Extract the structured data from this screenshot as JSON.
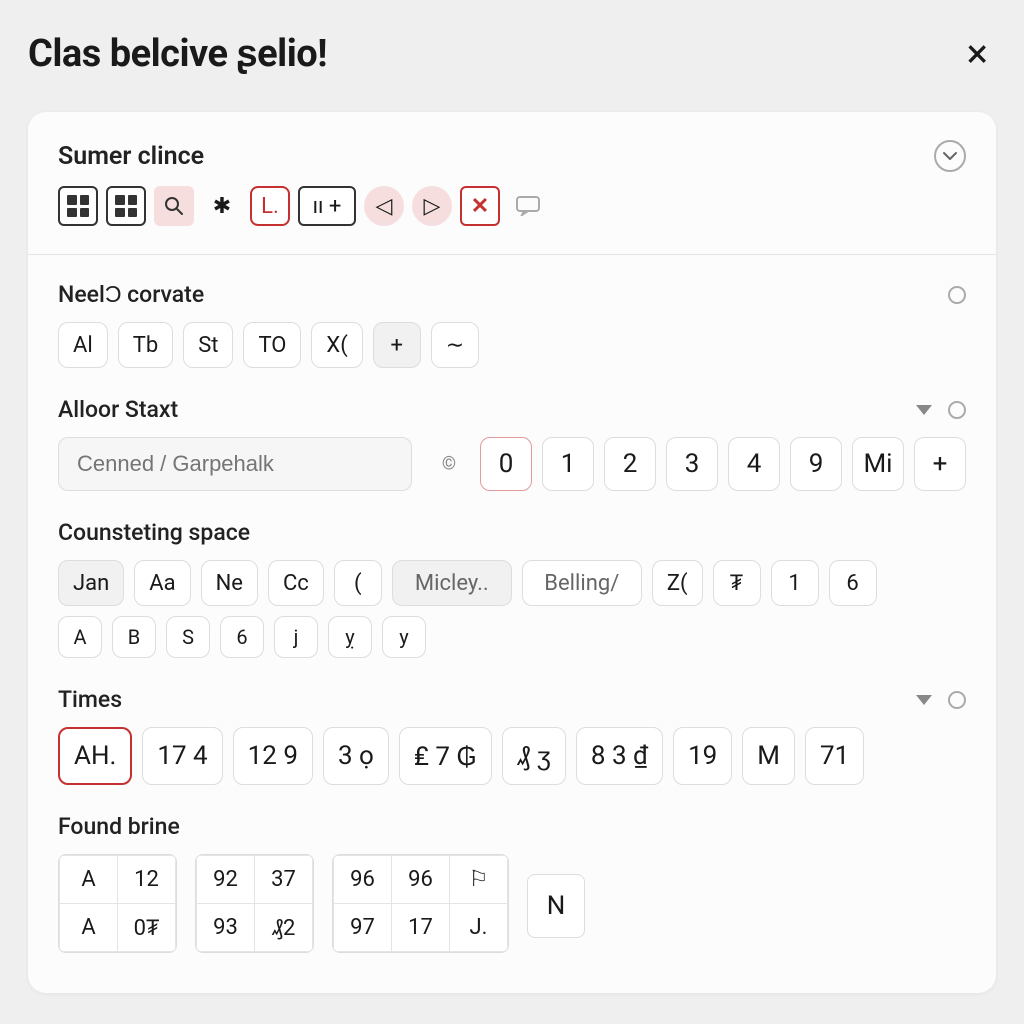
{
  "header": {
    "title": "Clas belcive ʂelio!",
    "close_icon": "×"
  },
  "sections": {
    "sumer": {
      "label": "Sumer clince",
      "toolbar": {
        "grid1": "grid",
        "grid2": "grid",
        "search": "search",
        "star": "✱",
        "L": "L.",
        "pause_plus": "ıı +",
        "back": "◁",
        "fwd": "▷",
        "x": "✕",
        "chat": "⌂"
      }
    },
    "neel": {
      "label": "NeelƆ corvate",
      "chips": [
        "Al",
        "Tb",
        "St",
        "TO",
        "X(",
        "+",
        "∼"
      ]
    },
    "alloor": {
      "label": "Alloor Staxt",
      "input_placeholder": "Cenned / Garpehalk",
      "input_trailing": "©",
      "numbers": [
        "0",
        "1",
        "2",
        "3",
        "4",
        "9",
        "Mi",
        "+"
      ],
      "selected_index": 0
    },
    "count": {
      "label": "Counsteting space",
      "row1": [
        "Jan",
        "Aa",
        "Ne",
        "Cc",
        "(",
        "Micley..",
        "Belling/",
        "Z(",
        "₮",
        "1",
        "6"
      ],
      "row2": [
        "A",
        "B",
        "S",
        "6",
        "j",
        "ỵ",
        "y"
      ]
    },
    "times": {
      "label": "Times",
      "chips": [
        "AH.",
        "17 4",
        "12 9",
        "3  ọ",
        "₤ 7 ₲",
        "₰ ʒ",
        "8 3 ₫",
        "19",
        "M",
        "71"
      ],
      "selected_index": 0
    },
    "found": {
      "label": "Found brine",
      "table1": [
        [
          "A",
          "12"
        ],
        [
          "A",
          "0₮"
        ]
      ],
      "table2": [
        [
          "92",
          "37"
        ],
        [
          "93",
          "₰2"
        ]
      ],
      "table3": [
        [
          "96",
          "96",
          "⚐"
        ],
        [
          "97",
          "17",
          "J."
        ]
      ],
      "solo": "N"
    }
  }
}
